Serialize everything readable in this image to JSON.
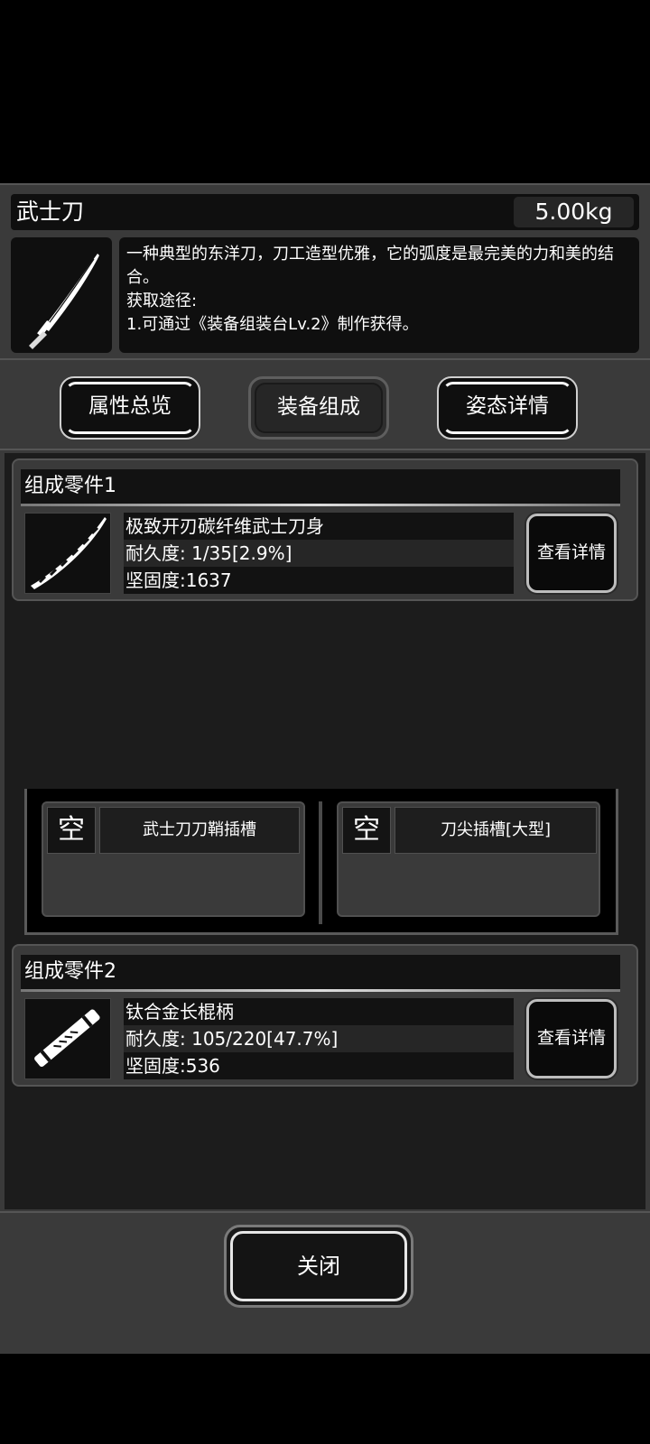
{
  "item": {
    "name": "武士刀",
    "weight": "5.00kg",
    "description": "一种典型的东洋刀，刀工造型优雅，它的弧度是最完美的力和美的结合。\n获取途径:\n1.可通过《装备组装台Lv.2》制作获得。",
    "icon": "katana-icon"
  },
  "tabs": [
    {
      "label": "属性总览"
    },
    {
      "label": "装备组成"
    },
    {
      "label": "姿态详情"
    }
  ],
  "parts": [
    {
      "header": "组成零件1",
      "name": "极致开刃碳纤维武士刀身",
      "durability": "耐久度: 1/35[2.9%]",
      "hardness": "坚固度:1637",
      "detail_label": "查看详情",
      "icon": "blade-icon"
    },
    {
      "header": "组成零件2",
      "name": "钛合金长棍柄",
      "durability": "耐久度: 105/220[47.7%]",
      "hardness": "坚固度:536",
      "detail_label": "查看详情",
      "icon": "handle-icon"
    }
  ],
  "slots": [
    {
      "status": "空",
      "name": "武士刀刀鞘插槽"
    },
    {
      "status": "空",
      "name": "刀尖插槽[大型]"
    }
  ],
  "footer": {
    "close_label": "关闭"
  }
}
